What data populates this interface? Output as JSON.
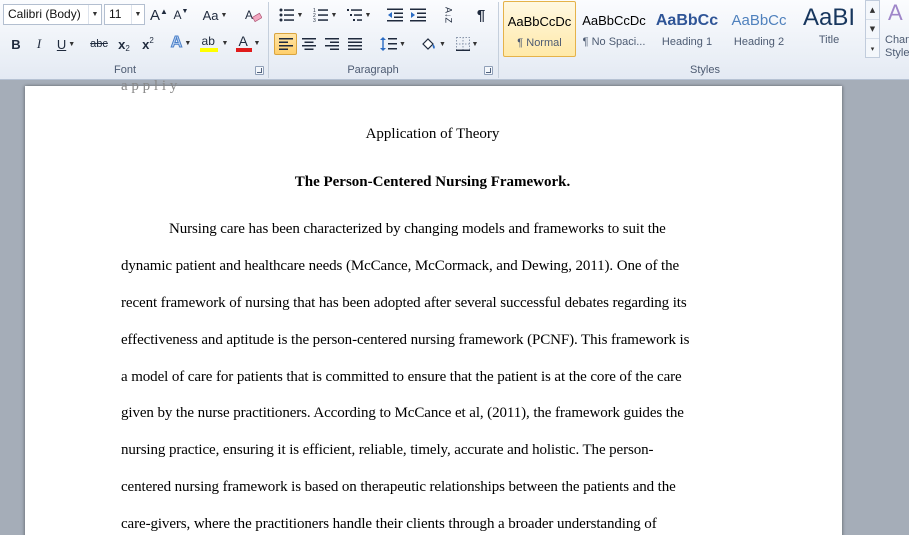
{
  "ribbon": {
    "font": {
      "group_label": "Font",
      "font_name": "Calibri (Body)",
      "font_size": "11",
      "grow_label": "A",
      "shrink_label": "A",
      "change_case_label": "Aa",
      "bold_label": "B",
      "italic_label": "I",
      "underline_label": "U",
      "strikethrough_label": "abc",
      "subscript_label": "x",
      "subscript_mark": "2",
      "superscript_label": "x",
      "superscript_mark": "2",
      "effects_label": "A",
      "highlight_label": "ab",
      "font_color_label": "A",
      "highlight_color": "#ffff00",
      "font_color": "#e01b1b"
    },
    "paragraph": {
      "group_label": "Paragraph",
      "sort_label": "A↓Z",
      "pilcrow_label": "¶"
    },
    "styles": {
      "group_label": "Styles",
      "tiles": [
        {
          "sample": "AaBbCcDc",
          "name": "¶ Normal"
        },
        {
          "sample": "AaBbCcDc",
          "name": "¶ No Spaci..."
        },
        {
          "sample": "AaBbCc",
          "name": "Heading 1"
        },
        {
          "sample": "AaBbCc",
          "name": "Heading 2"
        },
        {
          "sample": "AaBI",
          "name": "Title"
        }
      ],
      "change_styles_label": "Change Styles",
      "change_styles_line1": "Chan",
      "change_styles_line2": "Style",
      "heading_color": "#2f5597"
    }
  },
  "document": {
    "cut_text": "a    p p     l     i    y",
    "title": "Application of Theory",
    "heading": "The Person-Centered Nursing Framework.",
    "lines": [
      "Nursing care has been characterized by changing models and frameworks to suit the",
      "dynamic patient and healthcare needs (McCance, McCormack, and Dewing, 2011). One of the",
      "recent framework of nursing that has been adopted after several successful debates regarding its",
      "effectiveness and aptitude is the person-centered nursing framework (PCNF). This framework is",
      "a model of care for patients that is committed to ensure that the patient is at the core of the care",
      "given by the nurse practitioners. According to McCance et al, (2011), the framework guides the",
      "nursing practice, ensuring it is efficient, reliable, timely, accurate and holistic. The person-",
      "centered nursing framework is based on therapeutic relationships between the patients and the",
      "care-givers, where the practitioners handle their clients through a broader understanding of"
    ]
  }
}
